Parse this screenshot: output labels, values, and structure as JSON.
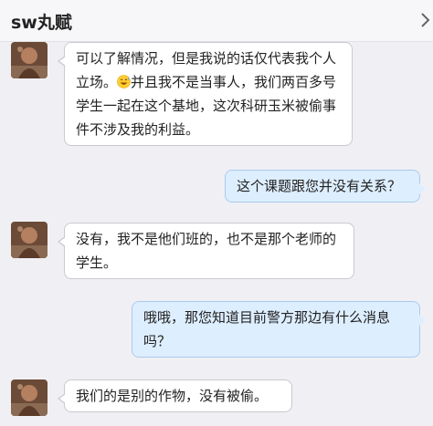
{
  "header": {
    "title": "sw丸赋",
    "menu_icon": "chevron-right-icon"
  },
  "messages": [
    {
      "sender": "contact",
      "avatar_icon": "contact-avatar",
      "text_before": "可以了解情况，但是我说的话仅代表我个人立场。",
      "emoji_icon": "grinning-sweat-emoji-icon",
      "text_after": "并且我不是当事人，我们两百多号学生一起在这个基地，这次科研玉米被偷事件不涉及我的利益。"
    },
    {
      "sender": "me",
      "text": "这个课题跟您并没有关系？"
    },
    {
      "sender": "contact",
      "avatar_icon": "contact-avatar",
      "text": "没有，我不是他们班的，也不是那个老师的学生。"
    },
    {
      "sender": "me",
      "text": "哦哦，那您知道目前警方那边有什么消息吗？"
    },
    {
      "sender": "contact",
      "avatar_icon": "contact-avatar",
      "text": "我们的是别的作物，没有被偷。"
    }
  ],
  "colors": {
    "background": "#f0f0f4",
    "incoming_bubble": "#ffffff",
    "outgoing_bubble": "#ddeeff",
    "outgoing_border": "#a9cbee"
  }
}
